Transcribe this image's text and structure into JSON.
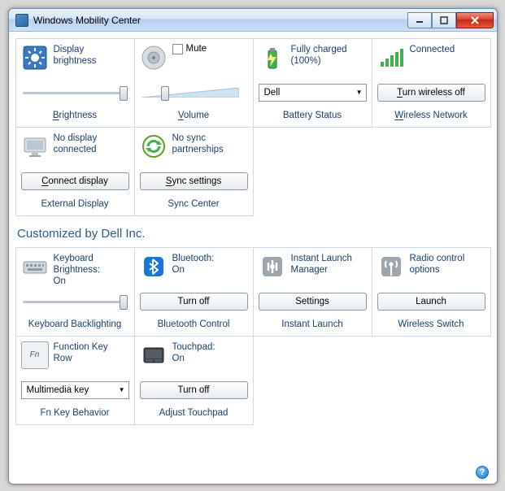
{
  "window": {
    "title": "Windows Mobility Center"
  },
  "tiles_row1": [
    {
      "desc": "Display\nbrightness",
      "footer": "Brightness"
    },
    {
      "mute": "Mute",
      "footer": "Volume"
    },
    {
      "desc": "Fully charged\n(100%)",
      "select": "Dell",
      "footer": "Battery Status"
    },
    {
      "desc": "Connected",
      "btn": "Turn wireless off",
      "footer": "Wireless Network"
    }
  ],
  "tiles_row2": [
    {
      "desc": "No display\nconnected",
      "btn": "Connect display",
      "footer": "External Display"
    },
    {
      "desc": "No sync\npartnerships",
      "btn": "Sync settings",
      "footer": "Sync Center"
    }
  ],
  "section": "Customized by Dell Inc.",
  "tiles_row3": [
    {
      "desc": "Keyboard\nBrightness:\nOn",
      "footer": "Keyboard Backlighting"
    },
    {
      "desc": "Bluetooth:\nOn",
      "btn": "Turn off",
      "footer": "Bluetooth Control"
    },
    {
      "desc": "Instant Launch\nManager",
      "btn": "Settings",
      "footer": "Instant Launch"
    },
    {
      "desc": "Radio control\noptions",
      "btn": "Launch",
      "footer": "Wireless Switch"
    }
  ],
  "tiles_row4": [
    {
      "desc": "Function Key\nRow",
      "select": "Multimedia key",
      "footer": "Fn Key Behavior"
    },
    {
      "desc": "Touchpad:\nOn",
      "btn": "Turn off",
      "footer": "Adjust Touchpad"
    }
  ],
  "hotkeys": {
    "brightness": "B",
    "volume": "V",
    "battery": "B",
    "wireless": "W",
    "turnwireless": "T",
    "connect": "C",
    "sync": "S"
  }
}
